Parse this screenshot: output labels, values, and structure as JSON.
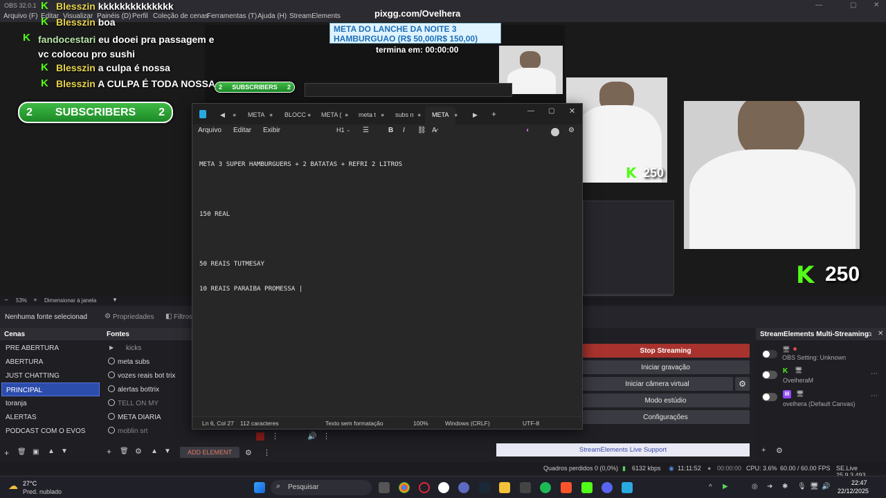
{
  "window": {
    "title": "OBS 32.0.1"
  },
  "menu": [
    "Arquivo (F)",
    "Editar",
    "Visualizar",
    "Painéis (D)",
    "Perfil",
    "Coleção de cenas",
    "Ferramentas (T)",
    "Ajuda (H)",
    "StreamElements"
  ],
  "overlay": {
    "url": "pixgg.com/Ovelhera",
    "meta_title": "META DO LANCHE DA NOITE 3 HAMBURGUAO (R$ 50,00/R$ 150,00)",
    "meta_suffix": "termina em: 00:00:00",
    "chat": [
      {
        "user": "Blesszin",
        "msg": "kkkkkkkkkkkkkk"
      },
      {
        "user": "Blesszin",
        "msg": "boa"
      },
      {
        "user": "fandocestari",
        "msg": "eu dooei pra passagem e vc colocou pro sushi"
      },
      {
        "user": "Blesszin",
        "msg": "a culpa é nossa"
      },
      {
        "user": "Blesszin",
        "msg": "A CULPA É TODA NOSSA"
      }
    ],
    "subs_count": "2",
    "subs_label": "SUBSCRIBERS",
    "followers": "250"
  },
  "preview_bar": {
    "zoom": "53%",
    "mode": "Dimensionar à janela"
  },
  "source_bar": {
    "none_selected": "Nenhuma fonte selecionad",
    "properties": "Propriedades",
    "filters": "Filtros"
  },
  "scenes": {
    "title": "Cenas",
    "items": [
      "PRE ABERTURA",
      "ABERTURA",
      "JUST CHATTING",
      "PRINCIPAL",
      "toranja",
      "ALERTAS",
      "PODCAST COM O EVOS"
    ],
    "active": "PRINCIPAL"
  },
  "sources": {
    "title": "Fontes",
    "items": [
      "kicks",
      "meta subs",
      "vozes reais bot trix",
      "alertas bottrix",
      "TELL ON MY",
      "META DIARIA",
      "moblin srt"
    ],
    "add_element": "ADD ELEMENT"
  },
  "controls": {
    "stop": "Stop Streaming",
    "record": "Iniciar gravação",
    "virtual_cam": "Iniciar câmera virtual",
    "studio": "Modo estúdio",
    "settings": "Configurações",
    "support": "StreamElements Live Support"
  },
  "multistream": {
    "title": "StreamElements Multi-Streaming",
    "rows": [
      {
        "label": "OBS Setting: Unknown"
      },
      {
        "label": "OvelheraM"
      },
      {
        "label": "ovelhera (Default Canvas)"
      }
    ]
  },
  "notepad": {
    "tabs": [
      "META",
      "BLOCC",
      "META (",
      "meta t",
      "subs n",
      "META"
    ],
    "menu": [
      "Arquivo",
      "Editar",
      "Exibir"
    ],
    "heading": "H1",
    "lines": [
      "META 3 SUPER HAMBURGUERS + 2 BATATAS + REFRI 2 LITROS",
      "",
      "150 REAL",
      "",
      "50 REAIS TUTMESAY",
      "10 REAIS PARAIBA PROMESSA |"
    ],
    "status": {
      "position": "Ln 6, Col 27",
      "chars": "112 caracteres",
      "format": "Texto sem formatação",
      "zoom": "100%",
      "eol": "Windows (CRLF)",
      "encoding": "UTF-8"
    }
  },
  "status": {
    "dropped": "Quadros perdidos 0 (0,0%)",
    "bitrate": "6132 kbps",
    "live_time": "11:11:52",
    "rec_time": "00:00:00",
    "cpu": "CPU: 3.6%",
    "fps": "60.00 / 60.00 FPS",
    "se_version": "SE.Live 25.9.3.493"
  },
  "taskbar": {
    "weather_temp": "27°C",
    "weather_desc": "Pred. nublado",
    "search": "Pesquisar",
    "time": "22:47",
    "date": "22/12/2025"
  },
  "colors": {
    "kick_green": "#53fc18",
    "stop_red": "#a8332e",
    "scene_active": "#2d4dad"
  }
}
